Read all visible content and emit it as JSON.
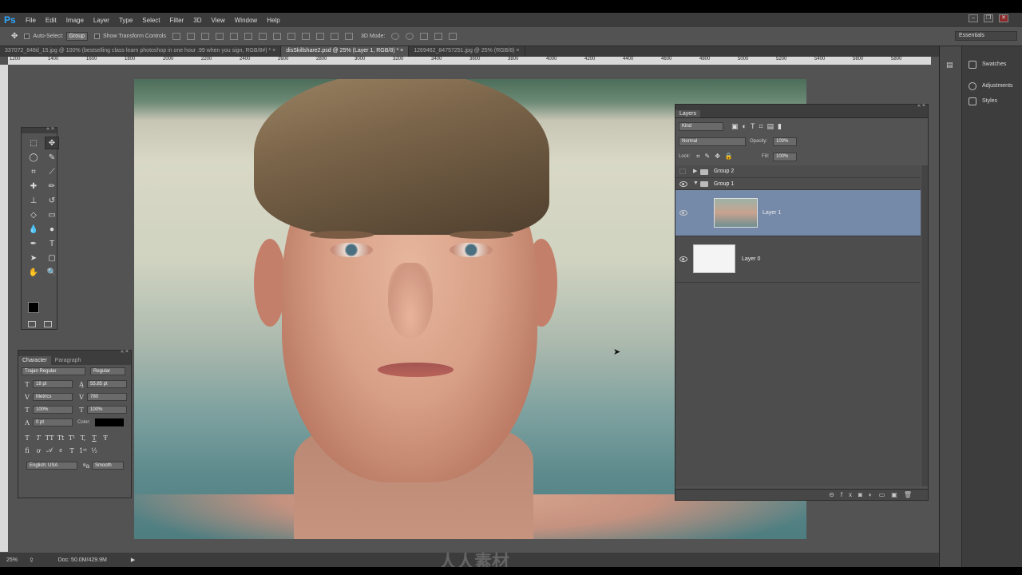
{
  "app": {
    "logo": "Ps"
  },
  "menu": [
    "File",
    "Edit",
    "Image",
    "Layer",
    "Type",
    "Select",
    "Filter",
    "3D",
    "View",
    "Window",
    "Help"
  ],
  "options": {
    "auto_select_label": "Auto-Select:",
    "auto_select_value": "Group",
    "show_transform_label": "Show Transform Controls",
    "mode_3d_label": "3D Mode:",
    "workspace": "Essentials"
  },
  "tabs": [
    {
      "label": "337072_848d_15.jpg @ 100% (bestselling class learn photoshop in one hour .99 when you sign, RGB/8#) *",
      "active": false
    },
    {
      "label": "disSkillshare2.psd @ 25% (Layer 1, RGB/8) *",
      "active": true
    },
    {
      "label": "1269462_84757251.jpg @ 25% (RGB/8)",
      "active": false
    }
  ],
  "ruler_ticks": [
    "1200",
    "1400",
    "1600",
    "1800",
    "2000",
    "2200",
    "2400",
    "2600",
    "2800",
    "3000",
    "3200",
    "3400",
    "3600",
    "3800",
    "4000",
    "4200",
    "4400",
    "4600",
    "4800",
    "5000",
    "5200",
    "5400",
    "5600",
    "5800"
  ],
  "character": {
    "tab_character": "Character",
    "tab_paragraph": "Paragraph",
    "font_family": "Trajan Regular",
    "font_style": "Regular",
    "font_size": "18 pt",
    "leading": "55.85 pt",
    "kerning": "Metrics",
    "tracking": "780",
    "vscale": "100%",
    "hscale": "100%",
    "baseline": "0 pt",
    "color_label": "Color:",
    "language": "English: USA",
    "antialias": "Smooth",
    "style_buttons": [
      "T",
      "T",
      "TT",
      "Tt",
      "T¹",
      "T,",
      "T",
      "Ŧ"
    ]
  },
  "layers": {
    "title": "Layers",
    "kind": "Kind",
    "blend_mode": "Normal",
    "opacity_label": "Opacity:",
    "opacity_value": "100%",
    "lock_label": "Lock:",
    "fill_label": "Fill:",
    "fill_value": "100%",
    "rows": [
      {
        "name": "Group 2",
        "type": "group",
        "visible": false,
        "expanded": false
      },
      {
        "name": "Group 1",
        "type": "group",
        "visible": true,
        "expanded": true
      },
      {
        "name": "Layer 1",
        "type": "layer",
        "visible": true,
        "selected": true
      },
      {
        "name": "Layer 0",
        "type": "layer",
        "visible": true,
        "selected": false
      }
    ]
  },
  "right_panels": {
    "swatches": "Swatches",
    "adjustments": "Adjustments",
    "styles": "Styles"
  },
  "status": {
    "zoom": "25%",
    "doc": "Doc: 50.0M/429.9M"
  },
  "watermark": "人人素材"
}
